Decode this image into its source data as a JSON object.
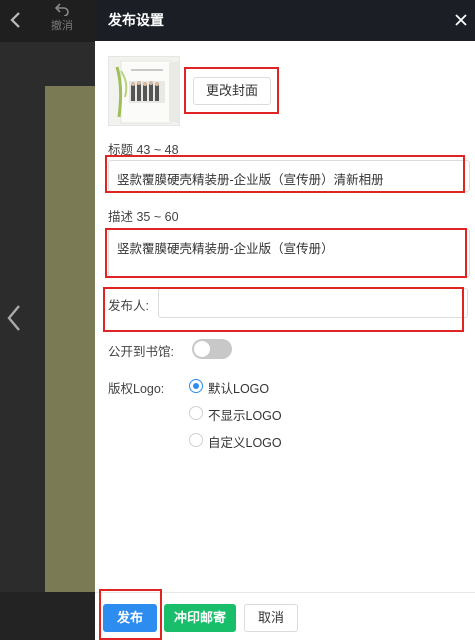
{
  "editor": {
    "undo_label": "撤消"
  },
  "panel": {
    "title": "发布设置",
    "change_cover_label": "更改封面",
    "title_label": "标题 43 ~ 48",
    "title_value": "竖款覆膜硬壳精装册-企业版（宣传册）清新相册",
    "desc_label": "描述 35 ~ 60",
    "desc_value": "竖款覆膜硬壳精装册-企业版（宣传册）",
    "publisher_label": "发布人:",
    "publisher_value": "",
    "public_label": "公开到书馆:",
    "public_enabled": false,
    "logo_label": "版权Logo:",
    "logo_options": [
      "默认LOGO",
      "不显示LOGO",
      "自定义LOGO"
    ],
    "logo_selected": "默认LOGO"
  },
  "footer": {
    "publish_label": "发布",
    "print_label": "冲印邮寄",
    "cancel_label": "取消"
  },
  "colors": {
    "header_bg": "#1b1e24",
    "primary": "#2d8cf0",
    "success": "#19be6b",
    "annotation": "#e02424"
  }
}
